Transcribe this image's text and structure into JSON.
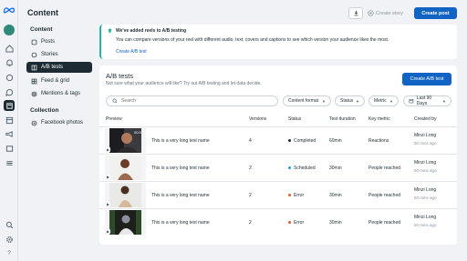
{
  "header": {
    "title": "Content",
    "create_story": "Create story",
    "create_post": "Create post"
  },
  "sidebar": {
    "sections": [
      {
        "label": "Content"
      },
      {
        "label": "Collection"
      }
    ],
    "items": [
      {
        "label": "Posts",
        "icon": "post-icon"
      },
      {
        "label": "Stories",
        "icon": "story-icon"
      },
      {
        "label": "A/B tests",
        "icon": "ab-test-icon",
        "active": true
      },
      {
        "label": "Feed & grid",
        "icon": "grid-icon"
      },
      {
        "label": "Mentions & tags",
        "icon": "mention-icon"
      },
      {
        "label": "Facebook photos",
        "icon": "photo-icon"
      }
    ]
  },
  "banner": {
    "title": "We've added reels to A/B testing",
    "text": "You can compare versions of your reel with different audio, text, covers and captions to see which version your audience likes the most.",
    "link": "Create A/B test"
  },
  "ab_tests": {
    "title": "A/B tests",
    "subtitle": "Not sure what your audience will like? Try out A/B testing and let data decide.",
    "create_button": "Create A/B test",
    "search_placeholder": "Search",
    "filters": [
      "Content format",
      "Status",
      "Metric",
      "Last 90 Days"
    ],
    "columns": [
      "Preview",
      "Versions",
      "Status",
      "Test duration",
      "Key metric",
      "Created by"
    ],
    "rows": [
      {
        "name": "This is a very long test name",
        "versions": "4",
        "status": "Completed",
        "status_color": "#1c2b33",
        "duration": "60min",
        "metric": "Reactions",
        "creator": "Minzi Long",
        "time": "50 mins ago",
        "thumb_duration": "00:59"
      },
      {
        "name": "This is a very long test name",
        "versions": "2",
        "status": "Scheduled",
        "status_color": "#1f9bd7",
        "duration": "30min",
        "metric": "People reached",
        "creator": "Minzi Long",
        "time": "50 mins ago"
      },
      {
        "name": "This is a very long test name",
        "versions": "2",
        "status": "Error",
        "status_color": "#e4572e",
        "duration": "30min",
        "metric": "People reached",
        "creator": "Minzi Long",
        "time": "50 mins ago"
      },
      {
        "name": "This is a very long test name",
        "versions": "2",
        "status": "Error",
        "status_color": "#e4572e",
        "duration": "30min",
        "metric": "People reached",
        "creator": "Minzi Long",
        "time": "50 mins ago"
      }
    ]
  },
  "colors": {
    "accent": "#1264c4",
    "banner_border": "#27b3a3",
    "active_nav": "#1c2b33"
  }
}
